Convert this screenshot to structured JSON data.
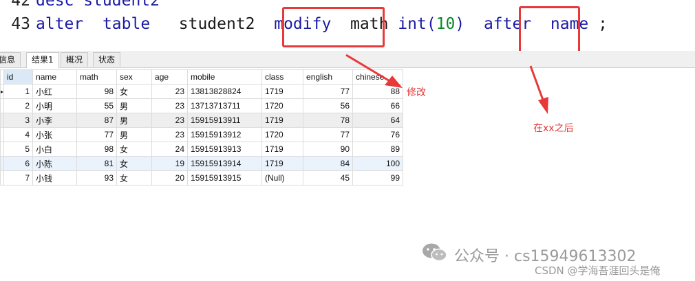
{
  "editor": {
    "line42": {
      "num": "42",
      "code": "desc student2"
    },
    "line43": {
      "num": "43",
      "tokens": [
        "alter",
        "table",
        "student2",
        "modify",
        "math",
        "int(",
        "10",
        ")",
        "after",
        "name",
        ";"
      ]
    }
  },
  "tabs": [
    "信息",
    "结果1",
    "概况",
    "状态"
  ],
  "table": {
    "headers": [
      "id",
      "name",
      "math",
      "sex",
      "age",
      "mobile",
      "class",
      "english",
      "chinese"
    ],
    "rows": [
      [
        "1",
        "小红",
        "98",
        "女",
        "23",
        "13813828824",
        "1719",
        "77",
        "88"
      ],
      [
        "2",
        "小明",
        "55",
        "男",
        "23",
        "13713713711",
        "1720",
        "56",
        "66"
      ],
      [
        "3",
        "小李",
        "87",
        "男",
        "23",
        "15915913911",
        "1719",
        "78",
        "64"
      ],
      [
        "4",
        "小张",
        "77",
        "男",
        "23",
        "15915913912",
        "1720",
        "77",
        "76"
      ],
      [
        "5",
        "小白",
        "98",
        "女",
        "24",
        "15915913913",
        "1719",
        "90",
        "89"
      ],
      [
        "6",
        "小陈",
        "81",
        "女",
        "19",
        "15915913914",
        "1719",
        "84",
        "100"
      ],
      [
        "7",
        "小钱",
        "93",
        "女",
        "20",
        "15915913915",
        "(Null)",
        "45",
        "99"
      ]
    ]
  },
  "annotations": {
    "modify": "修改",
    "after": "在xx之后"
  },
  "watermark": {
    "line1": "公众号 · cs15949613302",
    "line2": "CSDN @学海吾涯回头是俺"
  },
  "colors": {
    "annotation": "#e8393a",
    "keyword": "#1a1aa6",
    "number": "#0a8a2a"
  }
}
